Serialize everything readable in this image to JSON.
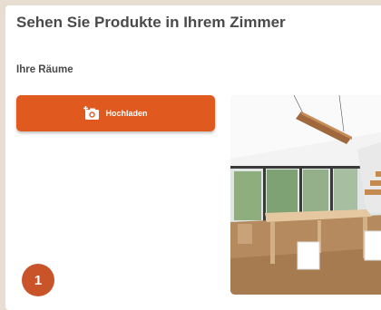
{
  "page": {
    "title": "Sehen Sie Produkte in Ihrem Zimmer",
    "section_label": "Ihre Räume"
  },
  "upload_button": {
    "label": "Hochladen",
    "icon": "camera-plus-icon",
    "color": "#e05a20"
  },
  "rooms": [
    {
      "label": ""
    }
  ],
  "step_badge": {
    "number": "1",
    "color": "#c9542a"
  },
  "colors": {
    "background": "#e8ddd1",
    "text": "#4a4a4a",
    "accent": "#e05a20"
  }
}
